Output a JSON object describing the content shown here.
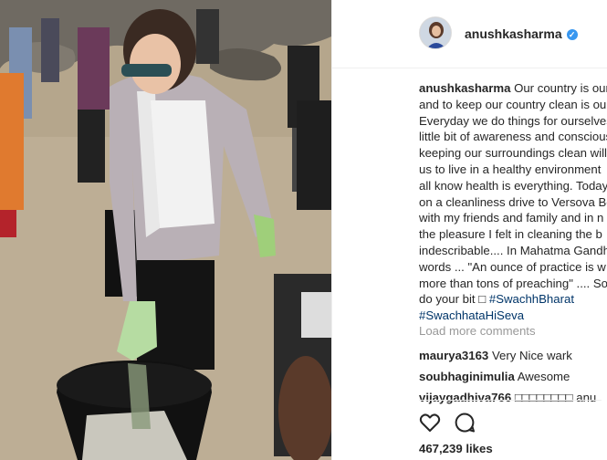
{
  "post": {
    "username": "anushkasharma",
    "verified_glyph": "✓"
  },
  "caption": {
    "username": "anushkasharma",
    "lines": [
      " Our country is our",
      "and to keep our country clean is our",
      "Everyday we do things for ourselves",
      "little bit of awareness and conscious",
      "keeping our surroundings clean will",
      "us to live in a healthy environment",
      "all know health is everything. Today",
      "on a cleanliness drive to Versova Be",
      "with my friends and family and in n",
      "the pleasure I felt in cleaning the b",
      "indescribable.... In Mahatma Gandhi",
      "words ... \"An ounce of practice is w",
      "more than tons of preaching\" .... So",
      "do your bit □ "
    ],
    "hashtag_1": "#SwachhBharat",
    "hashtag_2": "#SwachhataHiSeva"
  },
  "load_more_label": "Load more comments",
  "comments": [
    {
      "user": "maurya3163",
      "text": "Very Nice wark"
    },
    {
      "user": "soubhaginimulia",
      "text": "Awesome"
    },
    {
      "user": "vijaygadhiva766",
      "text": "□□□□□□□□ anu"
    }
  ],
  "actions": {
    "like_icon": "heart-outline-icon",
    "comment_icon": "comment-bubble-icon"
  },
  "likes_label": "467,239 likes",
  "colors": {
    "verified": "#3897f0",
    "hashtag": "#003569",
    "muted": "#999999"
  }
}
